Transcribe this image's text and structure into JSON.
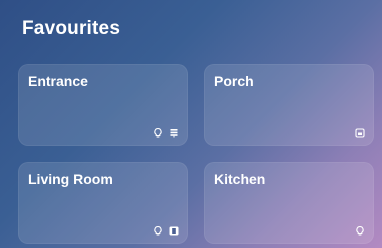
{
  "header": {
    "title": "Favourites"
  },
  "tiles": [
    {
      "label": "Entrance",
      "icons": [
        "lightbulb-icon",
        "blinds-icon"
      ]
    },
    {
      "label": "Porch",
      "icons": [
        "device-icon"
      ]
    },
    {
      "label": "Living Room",
      "icons": [
        "lightbulb-icon",
        "door-icon"
      ]
    },
    {
      "label": "Kitchen",
      "icons": [
        "lightbulb-icon"
      ]
    }
  ]
}
